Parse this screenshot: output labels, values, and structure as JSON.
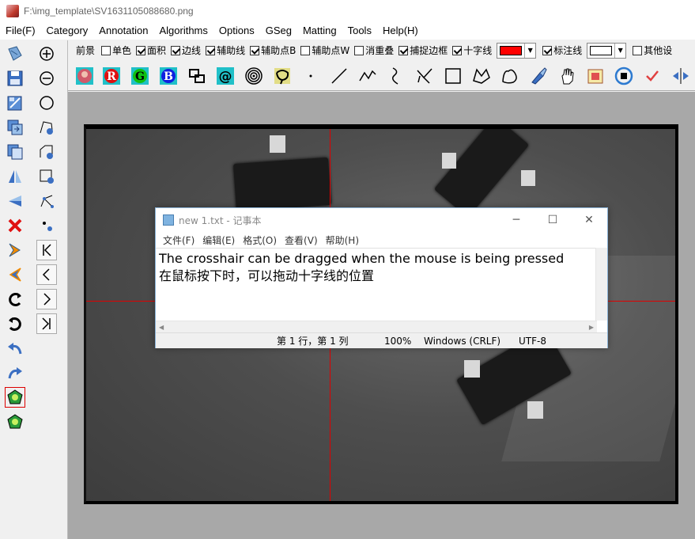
{
  "window": {
    "title": "F:\\img_template\\SV1631105088680.png"
  },
  "menu": [
    "File(F)",
    "Category",
    "Annotation",
    "Algorithms",
    "Options",
    "GSeg",
    "Matting",
    "Tools",
    "Help(H)"
  ],
  "options": {
    "foreground_label": "前景",
    "checkboxes": [
      {
        "label": "单色",
        "checked": false
      },
      {
        "label": "面积",
        "checked": true
      },
      {
        "label": "边线",
        "checked": true
      },
      {
        "label": "辅助线",
        "checked": true
      },
      {
        "label": "辅助点B",
        "checked": true
      },
      {
        "label": "辅助点W",
        "checked": false
      },
      {
        "label": "消重叠",
        "checked": false
      },
      {
        "label": "捕捉边框",
        "checked": true
      },
      {
        "label": "十字线",
        "checked": true
      }
    ],
    "crosshair_color": "#ff0000",
    "label_line": {
      "label": "标注线",
      "checked": true
    },
    "label_line_color": "#ffffff",
    "other_settings": {
      "label": "其他设",
      "checked": false
    }
  },
  "toolbar_icons": [
    "image-icon",
    "red-r-icon",
    "green-g-icon",
    "blue-b-icon",
    "link-icon",
    "at-icon",
    "rings-icon",
    "lasso-icon",
    "point-icon",
    "line-icon",
    "polyline-icon",
    "freehand-icon",
    "cut-icon",
    "rectangle-icon",
    "polygon-icon",
    "freehand-polygon-icon",
    "brush-icon",
    "hand-icon",
    "fill-icon",
    "target-icon",
    "check-icon",
    "split-icon"
  ],
  "toolbar_letters": {
    "r": "R",
    "g": "G",
    "b": "B",
    "at": "@"
  },
  "notepad": {
    "title": "new 1.txt - 记事本",
    "menu": [
      "文件(F)",
      "编辑(E)",
      "格式(O)",
      "查看(V)",
      "帮助(H)"
    ],
    "lines": [
      "The crosshair can be dragged when the mouse is being pressed",
      "在鼠标按下时，可以拖动十字线的位置"
    ],
    "status": {
      "position": "第 1 行，第 1 列",
      "zoom": "100%",
      "line_ending": "Windows (CRLF)",
      "encoding": "UTF-8"
    },
    "controls": {
      "minimize": "─",
      "maximize": "☐",
      "close": "✕"
    }
  }
}
